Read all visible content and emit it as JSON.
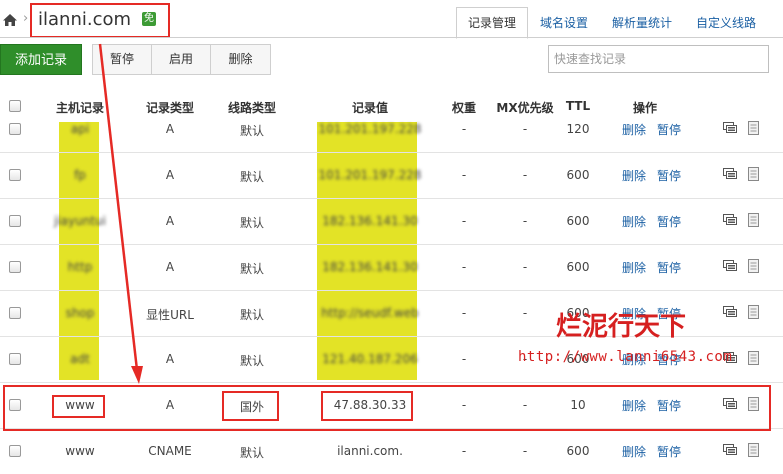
{
  "header": {
    "domain": "ilanni.com",
    "free_badge": "免",
    "tabs": [
      {
        "label": "记录管理",
        "active": true
      },
      {
        "label": "域名设置",
        "active": false
      },
      {
        "label": "解析量统计",
        "active": false
      },
      {
        "label": "自定义线路",
        "active": false
      }
    ]
  },
  "toolbar": {
    "add_label": "添加记录",
    "pause_label": "暂停",
    "enable_label": "启用",
    "delete_label": "删除",
    "search_placeholder": "快速查找记录"
  },
  "table": {
    "headers": [
      "主机记录",
      "记录类型",
      "线路类型",
      "记录值",
      "权重",
      "MX优先级",
      "TTL",
      "操作"
    ],
    "rows": [
      {
        "host": "api",
        "type": "A",
        "line": "默认",
        "value": "101.201.197.228",
        "weight": "-",
        "mx": "-",
        "ttl": "120",
        "delete": "删除",
        "pause": "暂停",
        "obscured": true
      },
      {
        "host": "fp",
        "type": "A",
        "line": "默认",
        "value": "101.201.197.228",
        "weight": "-",
        "mx": "-",
        "ttl": "600",
        "delete": "删除",
        "pause": "暂停",
        "obscured": true
      },
      {
        "host": "jiayuntui",
        "type": "A",
        "line": "默认",
        "value": "182.136.141.30",
        "weight": "-",
        "mx": "-",
        "ttl": "600",
        "delete": "删除",
        "pause": "暂停",
        "obscured": true
      },
      {
        "host": "http",
        "type": "A",
        "line": "默认",
        "value": "182.136.141.30",
        "weight": "-",
        "mx": "-",
        "ttl": "600",
        "delete": "删除",
        "pause": "暂停",
        "obscured": true
      },
      {
        "host": "shop",
        "type": "显性URL",
        "line": "默认",
        "value": "http://seudf.web",
        "weight": "-",
        "mx": "-",
        "ttl": "600",
        "delete": "删除",
        "pause": "暂停",
        "obscured": true
      },
      {
        "host": "adt",
        "type": "A",
        "line": "默认",
        "value": "121.40.187.206",
        "weight": "-",
        "mx": "-",
        "ttl": "600",
        "delete": "删除",
        "pause": "暂停",
        "obscured": true
      },
      {
        "host": "www",
        "type": "A",
        "line": "国外",
        "value": "47.88.30.33",
        "weight": "-",
        "mx": "-",
        "ttl": "10",
        "delete": "删除",
        "pause": "暂停",
        "obscured": false
      },
      {
        "host": "www",
        "type": "CNAME",
        "line": "默认",
        "value": "ilanni.com.",
        "weight": "-",
        "mx": "-",
        "ttl": "600",
        "delete": "删除",
        "pause": "暂停",
        "obscured": false
      }
    ]
  },
  "watermark": {
    "title": "烂泥行天下",
    "url": "http://www.lanni6543.com"
  },
  "colors": {
    "accent_red": "#e52a25",
    "link_blue": "#1a5fa3",
    "add_green": "#2f8e2a",
    "highlight_yellow": "#dede00"
  }
}
